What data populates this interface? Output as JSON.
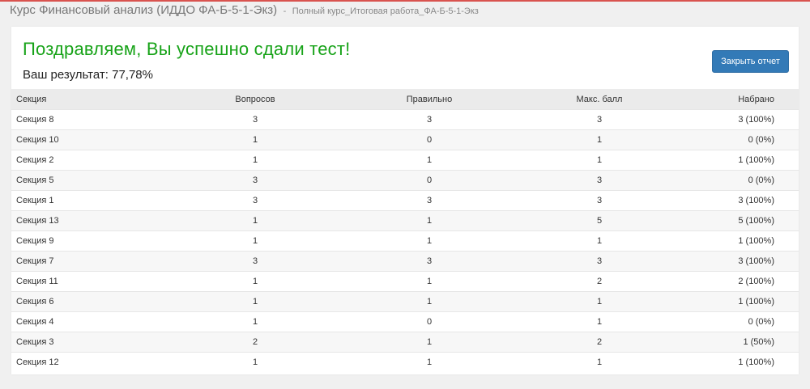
{
  "header": {
    "course_title": "Курс Финансовый анализ (ИДДО ФА-Б-5-1-Экз)",
    "separator": "-",
    "course_subtitle": "Полный курс_Итоговая работа_ФА-Б-5-1-Экз"
  },
  "result": {
    "congrats": "Поздравляем, Вы успешно сдали тест!",
    "score_text": "Ваш результат: 77,78%",
    "close_button": "Закрыть отчет"
  },
  "table": {
    "columns": [
      "Секция",
      "Вопросов",
      "Правильно",
      "Макс. балл",
      "Набрано"
    ],
    "rows": [
      [
        "Секция 8",
        "3",
        "3",
        "3",
        "3 (100%)"
      ],
      [
        "Секция 10",
        "1",
        "0",
        "1",
        "0 (0%)"
      ],
      [
        "Секция 2",
        "1",
        "1",
        "1",
        "1 (100%)"
      ],
      [
        "Секция 5",
        "3",
        "0",
        "3",
        "0 (0%)"
      ],
      [
        "Секция 1",
        "3",
        "3",
        "3",
        "3 (100%)"
      ],
      [
        "Секция 13",
        "1",
        "1",
        "5",
        "5 (100%)"
      ],
      [
        "Секция 9",
        "1",
        "1",
        "1",
        "1 (100%)"
      ],
      [
        "Секция 7",
        "3",
        "3",
        "3",
        "3 (100%)"
      ],
      [
        "Секция 11",
        "1",
        "1",
        "2",
        "2 (100%)"
      ],
      [
        "Секция 6",
        "1",
        "1",
        "1",
        "1 (100%)"
      ],
      [
        "Секция 4",
        "1",
        "0",
        "1",
        "0 (0%)"
      ],
      [
        "Секция 3",
        "2",
        "1",
        "2",
        "1 (50%)"
      ],
      [
        "Секция 12",
        "1",
        "1",
        "1",
        "1 (100%)"
      ]
    ]
  },
  "colors": {
    "accent_red": "#d9534f",
    "success_green": "#18a319",
    "button_blue": "#337ab7"
  }
}
